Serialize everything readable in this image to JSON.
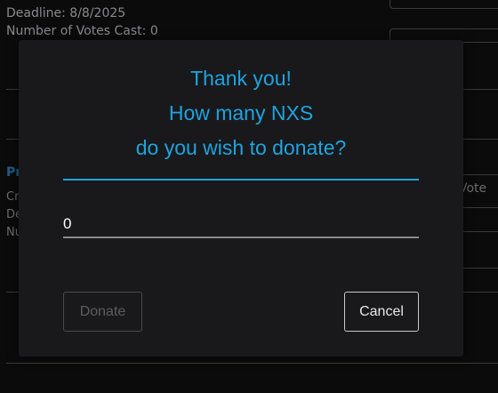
{
  "background": {
    "proposal": {
      "deadline": "Deadline: 8/8/2025",
      "votes_cast": "Number of Votes Cast: 0"
    },
    "section_label_partial": "Pr",
    "row_label_partials": [
      "Cr",
      "De",
      "Nu"
    ],
    "vote_button_partial": "Vote"
  },
  "dialog": {
    "title_lines": [
      "Thank you!",
      "How many NXS",
      "do you wish to donate?"
    ],
    "amount_value": "0",
    "donate_label": "Donate",
    "cancel_label": "Cancel"
  },
  "colors": {
    "accent": "#1fa3e0",
    "modal_bg": "#19191b",
    "page_bg": "#0b0b0c"
  }
}
